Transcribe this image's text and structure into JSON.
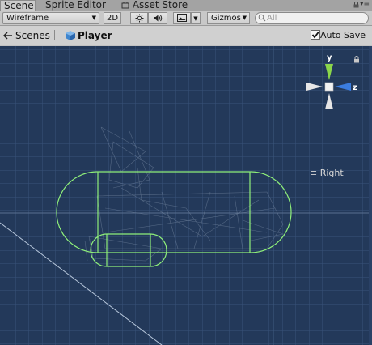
{
  "tabs": [
    {
      "label": "Scene",
      "active": true
    },
    {
      "label": "Sprite Editor",
      "active": false
    },
    {
      "label": "Asset Store",
      "active": false
    }
  ],
  "toolbar": {
    "draw_mode": "Wireframe",
    "mode_2d": "2D",
    "lighting_icon": "sun-icon",
    "audio_icon": "speaker-icon",
    "effects_icon": "image-icon",
    "gizmos_label": "Gizmos",
    "search_placeholder": "All"
  },
  "breadcrumb": {
    "scenes_label": "Scenes",
    "object_label": "Player",
    "autosave_label": "Auto Save",
    "autosave_checked": true
  },
  "gizmo": {
    "y_label": "y",
    "z_label": "z",
    "orientation_label": "Right"
  },
  "colors": {
    "scene_bg": "#23395a",
    "grid": "#3a5478",
    "collider": "#8ff07a",
    "y_axis": "#8bd64a",
    "z_axis": "#3b7de0"
  }
}
